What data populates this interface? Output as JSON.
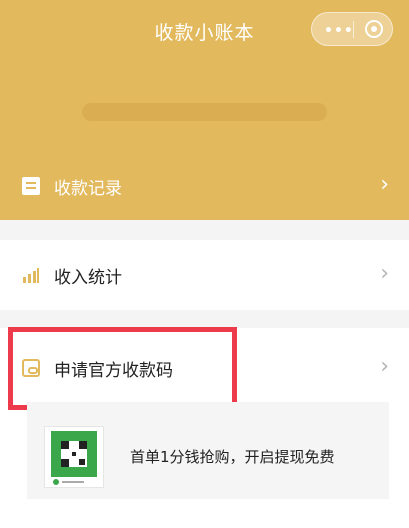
{
  "header": {
    "title": "收款小账本",
    "more_icon": "more-dots-icon",
    "close_icon": "target-close-icon"
  },
  "menu": {
    "records_label": "收款记录",
    "stats_label": "收入统计",
    "apply_label": "申请官方收款码"
  },
  "promo": {
    "text": "首单1分钱抢购，开启提现免费"
  },
  "colors": {
    "header": "#e3b95e",
    "highlight_border": "#ee3b4b"
  }
}
